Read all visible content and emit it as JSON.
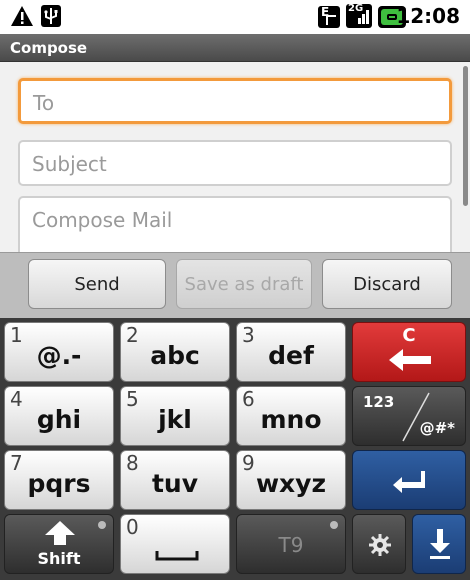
{
  "status_bar": {
    "time": "12:08",
    "icons": [
      "warning-icon",
      "usb-icon",
      "edge-network-icon",
      "signal-icon",
      "battery-icon"
    ],
    "network_label": "E",
    "signal_label": "2G"
  },
  "title": "Compose",
  "form": {
    "to_placeholder": "To",
    "subject_placeholder": "Subject",
    "body_placeholder": "Compose Mail"
  },
  "actions": {
    "send": "Send",
    "save_draft": "Save as draft",
    "discard": "Discard"
  },
  "keyboard": {
    "keys": [
      {
        "num": "1",
        "label": "@.-"
      },
      {
        "num": "2",
        "label": "abc"
      },
      {
        "num": "3",
        "label": "def"
      },
      {
        "num": "4",
        "label": "ghi"
      },
      {
        "num": "5",
        "label": "jkl"
      },
      {
        "num": "6",
        "label": "mno"
      },
      {
        "num": "7",
        "label": "pqrs"
      },
      {
        "num": "8",
        "label": "tuv"
      },
      {
        "num": "9",
        "label": "wxyz"
      },
      {
        "num": "0",
        "label": ""
      }
    ],
    "delete_label": "C",
    "symbols_top": "123",
    "symbols_bottom": "@#*",
    "shift_label": "Shift",
    "t9_label": "T9",
    "accent_colors": {
      "delete": "#c62222",
      "enter": "#24487f",
      "focus": "#f39a3c"
    }
  }
}
